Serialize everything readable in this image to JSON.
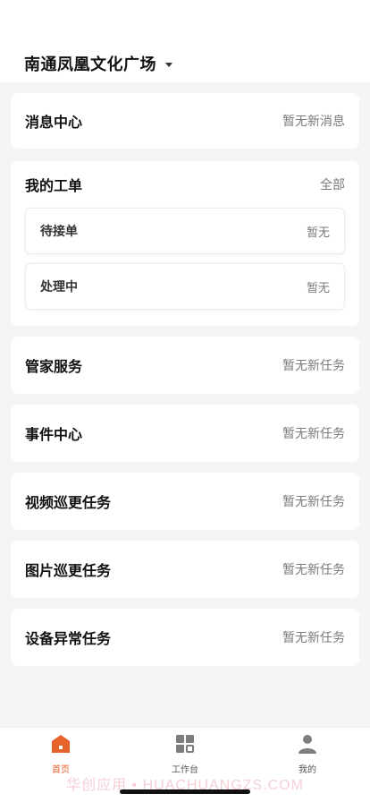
{
  "header": {
    "location": "南通凤凰文化广场"
  },
  "sections": {
    "messages": {
      "title": "消息中心",
      "status": "暂无新消息"
    },
    "orders": {
      "title": "我的工单",
      "action": "全部",
      "items": [
        {
          "title": "待接单",
          "status": "暂无"
        },
        {
          "title": "处理中",
          "status": "暂无"
        }
      ]
    },
    "housekeeper": {
      "title": "管家服务",
      "status": "暂无新任务"
    },
    "events": {
      "title": "事件中心",
      "status": "暂无新任务"
    },
    "video_patrol": {
      "title": "视频巡更任务",
      "status": "暂无新任务"
    },
    "image_patrol": {
      "title": "图片巡更任务",
      "status": "暂无新任务"
    },
    "device_anomaly": {
      "title": "设备异常任务",
      "status": "暂无新任务"
    }
  },
  "tabbar": {
    "items": [
      {
        "label": "首页",
        "icon": "home-icon",
        "active": true
      },
      {
        "label": "工作台",
        "icon": "grid-icon",
        "active": false
      },
      {
        "label": "我的",
        "icon": "user-icon",
        "active": false
      }
    ],
    "accent_color": "#e8622c"
  },
  "watermark": "华创应用 • HUACHUANGZS.COM"
}
